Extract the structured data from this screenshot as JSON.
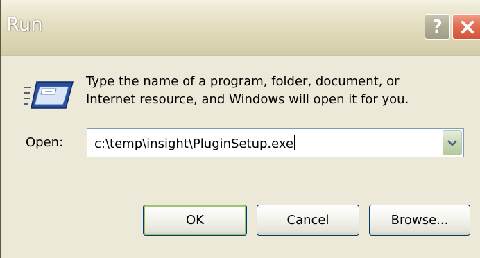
{
  "window": {
    "title": "Run",
    "help_icon": "help-icon",
    "close_icon": "close-icon"
  },
  "content": {
    "icon": "run-icon",
    "description_line1": "Type the name of a program, folder, document, or",
    "description_line2": "Internet resource, and Windows will open it for you.",
    "open_label": "Open:",
    "open_value": "c:\\temp\\insight\\PluginSetup.exe"
  },
  "buttons": {
    "ok": "OK",
    "cancel": "Cancel",
    "browse": "Browse..."
  },
  "colors": {
    "dialog_background": "#ece9d8",
    "default_button_highlight": "#9fc36f",
    "close_button": "#d2533a"
  }
}
